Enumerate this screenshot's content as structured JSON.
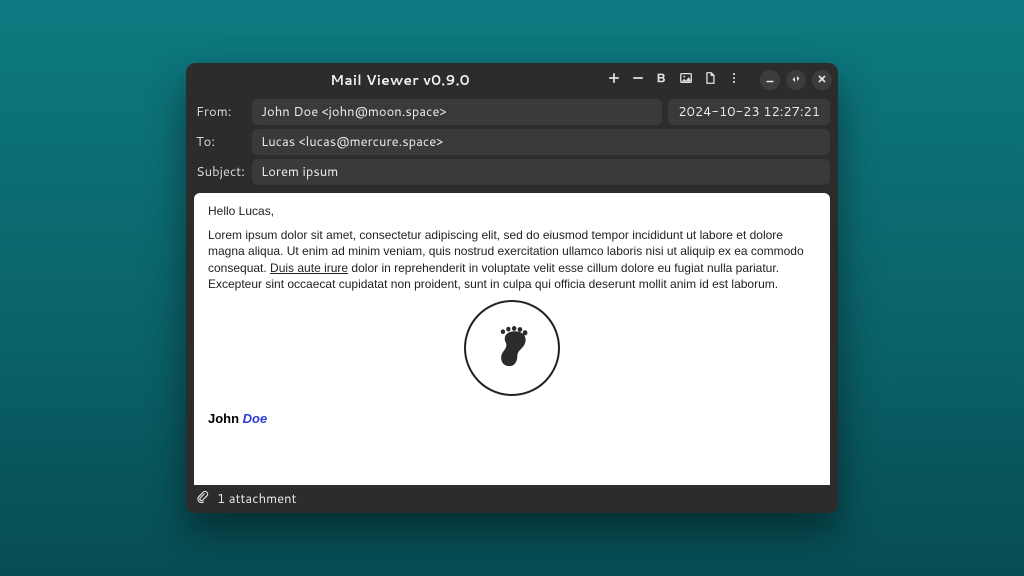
{
  "window": {
    "title": "Mail Viewer v0.9.0"
  },
  "toolbar": {
    "icons": {
      "add": "add-icon",
      "collapse": "collapse-icon",
      "format": "format-icon",
      "image": "image-icon",
      "file": "file-icon",
      "menu": "menu-icon"
    }
  },
  "headers": {
    "from_label": "From:",
    "from_value": "John Doe <john@moon.space>",
    "date_value": "2024-10-23 12:27:21",
    "to_label": "To:",
    "to_value": "Lucas <lucas@mercure.space>",
    "subject_label": "Subject:",
    "subject_value": "Lorem ipsum"
  },
  "body": {
    "greeting": "Hello Lucas,",
    "p1a": "Lorem ipsum dolor sit amet, consectetur adipiscing elit, sed do eiusmod tempor incididunt ut labore et dolore magna aliqua. Ut enim ad minim veniam, quis nostrud exercitation ullamco laboris nisi ut aliquip ex ea commodo consequat. ",
    "p1_underlined": "Duis aute irure",
    "p1b": " dolor in reprehenderit in voluptate velit esse cillum dolore eu fugiat nulla pariatur. Excepteur sint occaecat cupidatat non proident, sunt in culpa qui officia deserunt mollit anim id est laborum.",
    "sig_first": "John ",
    "sig_last": "Doe",
    "image_alt": "foot-icon"
  },
  "status": {
    "attachment_text": "1 attachment"
  }
}
